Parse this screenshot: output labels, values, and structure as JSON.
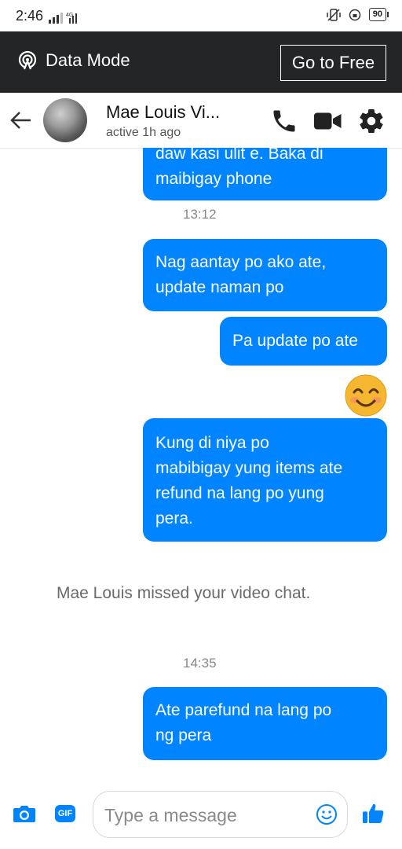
{
  "status_bar": {
    "time": "2:46",
    "network": "4G",
    "battery": "90"
  },
  "data_banner": {
    "label": "Data Mode",
    "cta": "Go to Free"
  },
  "header": {
    "name": "Mae Louis Vi...",
    "status": "active 1h ago"
  },
  "messages": [
    {
      "type": "sent",
      "lines": [
        "daw kasi ulit e. Baka di",
        "maibigay phone"
      ]
    },
    {
      "type": "timestamp",
      "text": "13:12"
    },
    {
      "type": "sent",
      "lines": [
        "Nag aantay po ako ate,",
        "update naman po"
      ]
    },
    {
      "type": "sent",
      "lines": [
        "Pa update po ate"
      ]
    },
    {
      "type": "emoji",
      "name": "smiling-face-emoji"
    },
    {
      "type": "sent",
      "lines": [
        "Kung di niya po",
        "mabibigay yung items ate",
        "refund na lang po yung",
        "pera."
      ]
    },
    {
      "type": "system",
      "text": "Mae Louis missed your video chat."
    },
    {
      "type": "timestamp",
      "text": "14:35"
    },
    {
      "type": "sent",
      "lines": [
        "Ate parefund na lang po",
        "ng pera"
      ]
    }
  ],
  "composer": {
    "placeholder": "Type a message",
    "gif_label": "GIF"
  },
  "colors": {
    "accent": "#0084ff",
    "banner": "#242526"
  }
}
